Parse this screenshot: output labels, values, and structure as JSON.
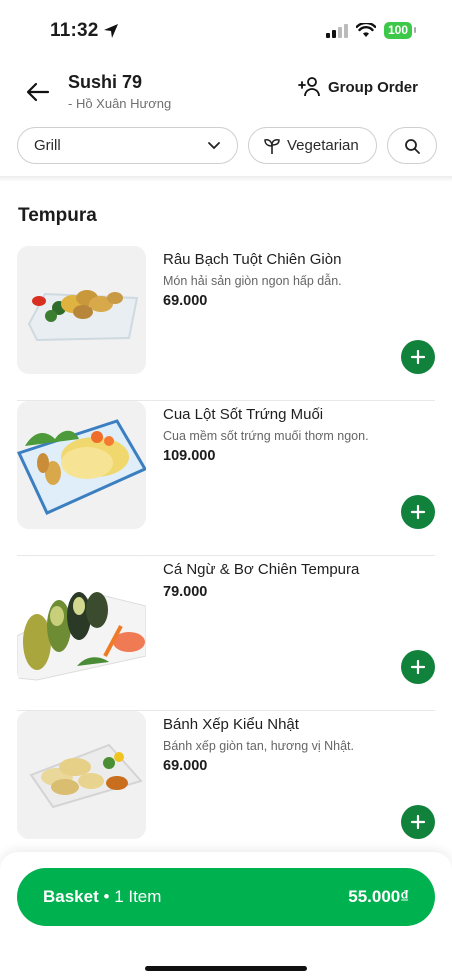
{
  "status_bar": {
    "time": "11:32",
    "battery": "100"
  },
  "header": {
    "store_name": "Sushi 79",
    "branch": "- Hồ Xuân Hương",
    "group_order": "Group Order"
  },
  "filters": {
    "category": "Grill",
    "vegetarian": "Vegetarian"
  },
  "section": {
    "title": "Tempura"
  },
  "items": [
    {
      "name": "Râu Bạch Tuột Chiên Giòn",
      "desc": "Món hải sản giòn ngon hấp dẫn.",
      "price": "69.000"
    },
    {
      "name": "Cua Lột Sốt Trứng Muối",
      "desc": "Cua mềm sốt trứng muối thơm ngon.",
      "price": "109.000"
    },
    {
      "name": "Cá Ngừ & Bơ Chiên Tempura",
      "desc": "",
      "price": "79.000"
    },
    {
      "name": "Bánh Xếp Kiểu Nhật",
      "desc": "Bánh xếp giòn tan, hương vị Nhật.",
      "price": "69.000"
    }
  ],
  "basket": {
    "label": "Basket",
    "count": "1 Item",
    "total": "55.000₫"
  },
  "colors": {
    "accent": "#00b14f",
    "add_button": "#11823b"
  }
}
